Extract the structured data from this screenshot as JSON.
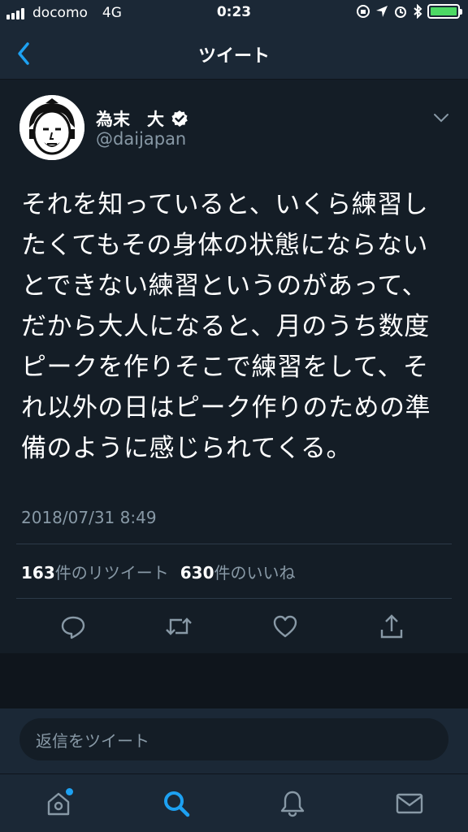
{
  "status_bar": {
    "carrier": "docomo",
    "network": "4G",
    "time": "0:23"
  },
  "nav": {
    "title": "ツイート",
    "back_icon": "chevron-left-icon"
  },
  "tweet": {
    "author_name": "為末　大",
    "author_handle": "@daijapan",
    "verified": true,
    "text": "それを知っていると、いくら練習したくてもその身体の状態にならないとできない練習というのがあって、だから大人になると、月のうち数度ピークを作りそこで練習をして、それ以外の日はピーク作りのための準備のように感じられてくる。",
    "timestamp": "2018/07/31 8:49",
    "retweets_count": "163",
    "retweets_label": "件のリツイート",
    "likes_count": "630",
    "likes_label": "件のいいね"
  },
  "reply": {
    "placeholder": "返信をツイート"
  },
  "colors": {
    "background": "#141d26",
    "bar": "#1b2836",
    "accent": "#1da1f2",
    "muted": "#8899a6",
    "battery": "#4cd964"
  },
  "tabs": [
    {
      "icon": "home-icon",
      "active": false,
      "notification_dot": true
    },
    {
      "icon": "search-icon",
      "active": true
    },
    {
      "icon": "bell-icon",
      "active": false
    },
    {
      "icon": "mail-icon",
      "active": false
    }
  ]
}
